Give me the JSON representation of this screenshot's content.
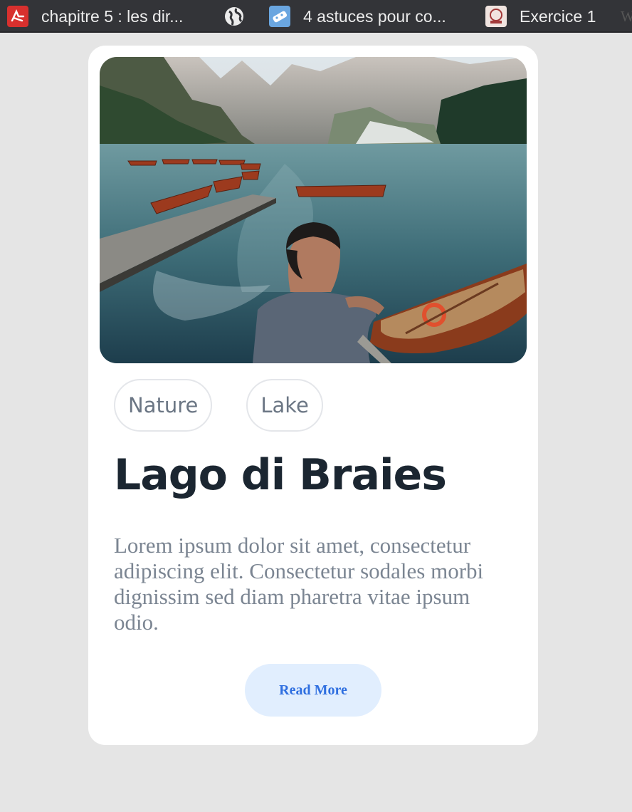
{
  "browser_tabs": [
    {
      "label": "chapitre 5 : les dir...",
      "icon": "pdf-icon"
    },
    {
      "label": "",
      "icon": "globe-icon"
    },
    {
      "label": "4 astuces pour co...",
      "icon": "controller-icon"
    },
    {
      "label": "Exercice 1",
      "icon": "site-logo-icon"
    },
    {
      "label": "W",
      "icon": ""
    }
  ],
  "card": {
    "image_alt": "Man sitting by a mountain lake with wooden rowboats",
    "tags": [
      "Nature",
      "Lake"
    ],
    "title": "Lago di Braies",
    "description": "Lorem ipsum dolor sit amet, consectetur adipiscing elit. Consectetur sodales morbi dignissim sed diam pharetra vitae ipsum odio.",
    "button_label": "Read More"
  },
  "colors": {
    "page_background": "#e5e5e5",
    "card_background": "#ffffff",
    "title": "#1b2631",
    "tag_text": "#6b7684",
    "description": "#7b8592",
    "button_background": "#e1eefe",
    "button_text": "#2f6fe0"
  }
}
